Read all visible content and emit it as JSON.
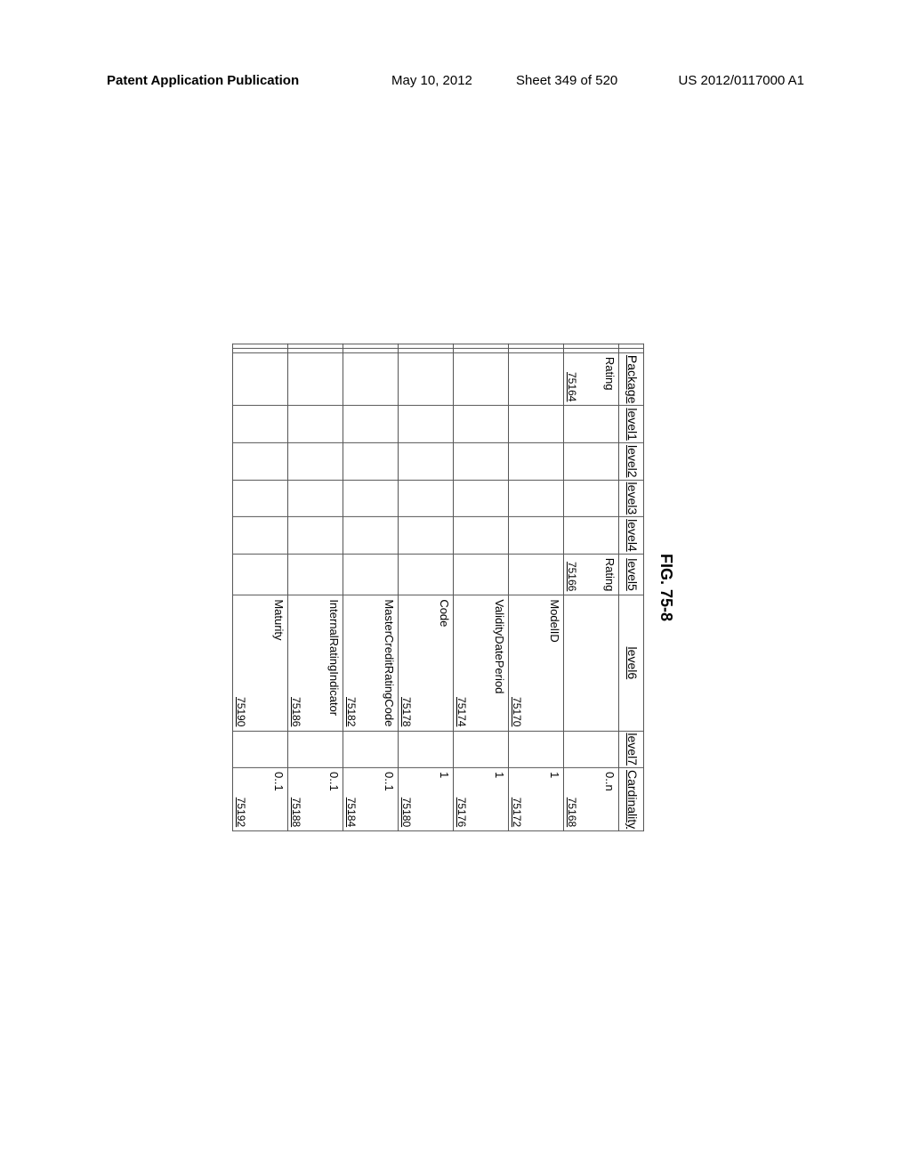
{
  "header": {
    "left": "Patent Application Publication",
    "mid_date": "May 10, 2012",
    "mid_sheet": "Sheet 349 of 520",
    "right": "US 2012/0117000 A1"
  },
  "figure_label": "FIG. 75-8",
  "columns": {
    "package": "Package",
    "l1": "level1",
    "l2": "level2",
    "l3": "level3",
    "l4": "level4",
    "l5": "level5",
    "l6": "level6",
    "l7": "level7",
    "card": "Cardinality"
  },
  "rows": [
    {
      "package": {
        "text": "Rating",
        "ref": "75164"
      },
      "l5": {
        "text": "Rating",
        "ref": "75166"
      },
      "l6": {
        "text": "",
        "ref": ""
      },
      "card": {
        "text": "0..n",
        "ref": "75168"
      }
    },
    {
      "package": {
        "text": "",
        "ref": ""
      },
      "l5": {
        "text": "",
        "ref": ""
      },
      "l6": {
        "text": "ModelID",
        "ref": "75170"
      },
      "card": {
        "text": "1",
        "ref": "75172"
      }
    },
    {
      "package": {
        "text": "",
        "ref": ""
      },
      "l5": {
        "text": "",
        "ref": ""
      },
      "l6": {
        "text": "ValidityDatePeriod",
        "ref": "75174"
      },
      "card": {
        "text": "1",
        "ref": "75176"
      }
    },
    {
      "package": {
        "text": "",
        "ref": ""
      },
      "l5": {
        "text": "",
        "ref": ""
      },
      "l6": {
        "text": "Code",
        "ref": "75178"
      },
      "card": {
        "text": "1",
        "ref": "75180"
      }
    },
    {
      "package": {
        "text": "",
        "ref": ""
      },
      "l5": {
        "text": "",
        "ref": ""
      },
      "l6": {
        "text": "MasterCreditRatingCode",
        "ref": "75182"
      },
      "card": {
        "text": "0..1",
        "ref": "75184"
      }
    },
    {
      "package": {
        "text": "",
        "ref": ""
      },
      "l5": {
        "text": "",
        "ref": ""
      },
      "l6": {
        "text": "InternalRatingIndicator",
        "ref": "75186"
      },
      "card": {
        "text": "0..1",
        "ref": "75188"
      }
    },
    {
      "package": {
        "text": "",
        "ref": ""
      },
      "l5": {
        "text": "",
        "ref": ""
      },
      "l6": {
        "text": "Maturity",
        "ref": "75190"
      },
      "card": {
        "text": "0..1",
        "ref": "75192"
      }
    }
  ]
}
